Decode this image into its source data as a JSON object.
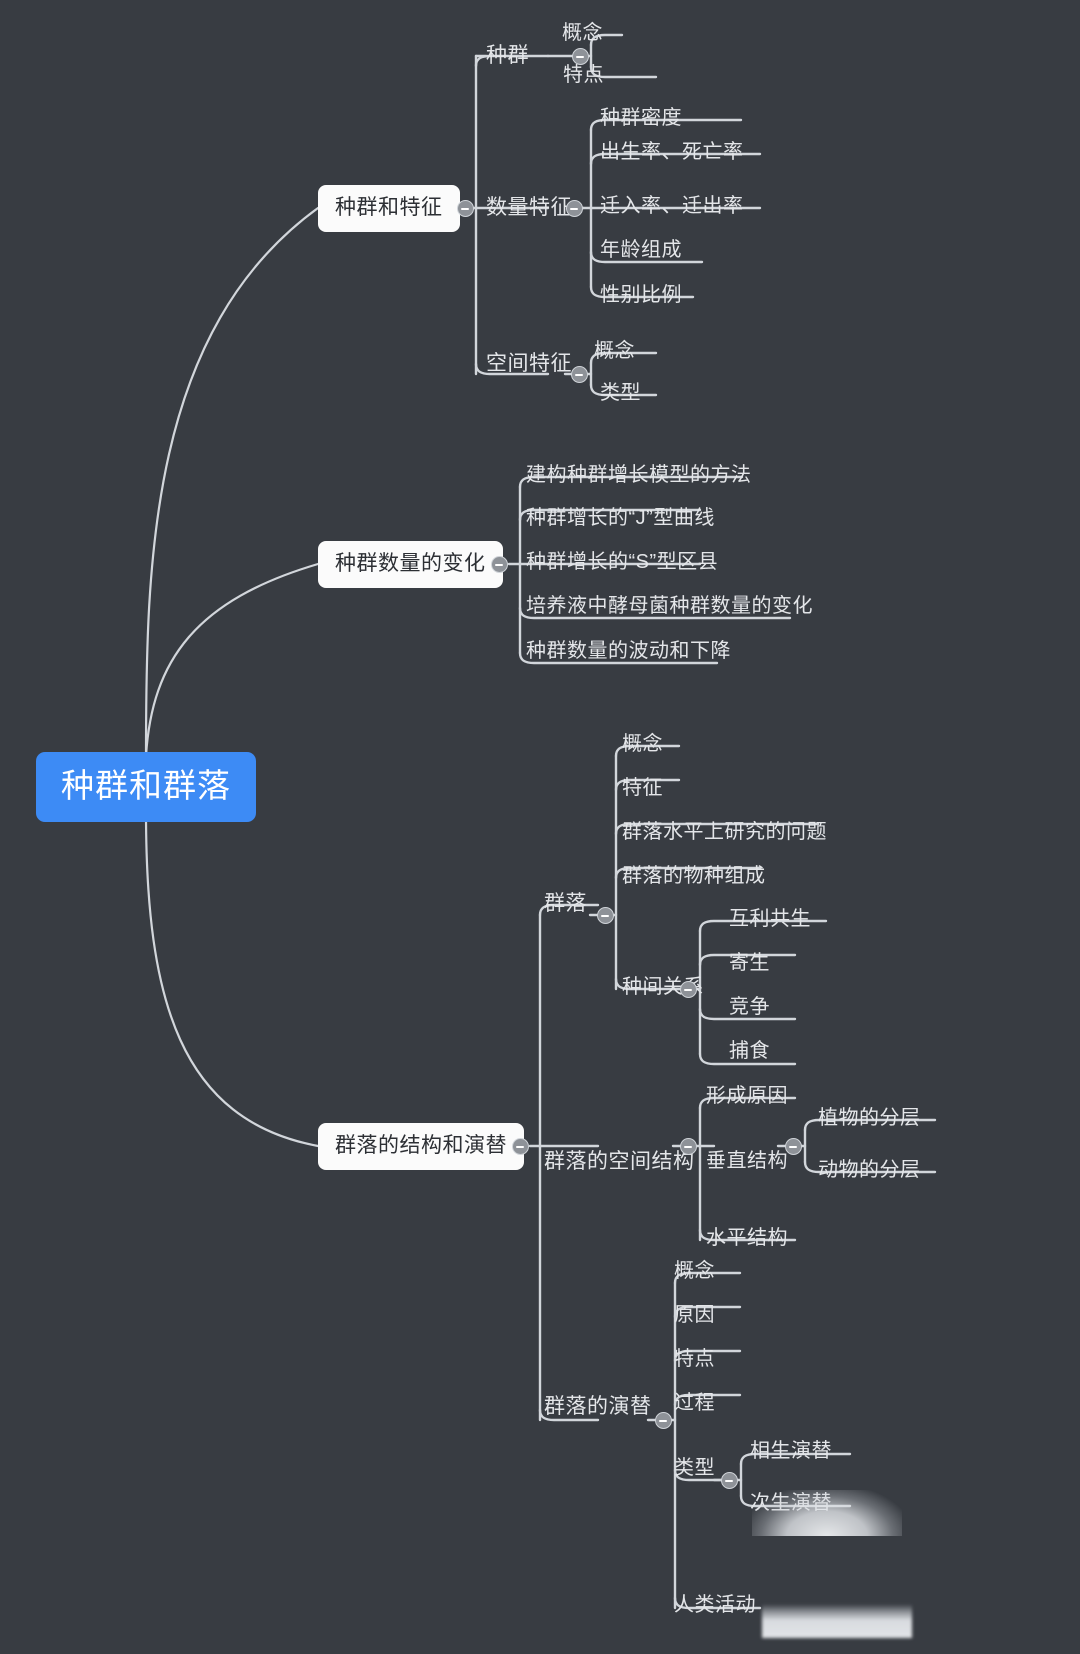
{
  "theme": {
    "background": "#383c42",
    "root_fill": "#3d8bf5",
    "root_text": "#ffffff",
    "box_fill": "#fbfbfb",
    "box_text": "#2c2f34",
    "branch_text": "#e4e6e9",
    "link_color": "#d2d6db",
    "toggle_fill": "#8e9298"
  },
  "root": {
    "label": "种群和群落"
  },
  "branches": [
    {
      "label": "种群和特征",
      "children": [
        {
          "label": "种群",
          "children": [
            {
              "label": "概念"
            },
            {
              "label": "特点"
            }
          ]
        },
        {
          "label": "数量特征",
          "children": [
            {
              "label": "种群密度"
            },
            {
              "label": "出生率、死亡率"
            },
            {
              "label": "迁入率、迁出率"
            },
            {
              "label": "年龄组成"
            },
            {
              "label": "性别比例"
            }
          ]
        },
        {
          "label": "空间特征",
          "children": [
            {
              "label": "概念"
            },
            {
              "label": "类型"
            }
          ]
        }
      ]
    },
    {
      "label": "种群数量的变化",
      "children": [
        {
          "label": "建构种群增长模型的方法"
        },
        {
          "label": "种群增长的“J”型曲线"
        },
        {
          "label": "种群增长的“S”型区县"
        },
        {
          "label": "培养液中酵母菌种群数量的变化"
        },
        {
          "label": "种群数量的波动和下降"
        }
      ]
    },
    {
      "label": "群落的结构和演替",
      "children": [
        {
          "label": "群落",
          "children": [
            {
              "label": "概念"
            },
            {
              "label": "特征"
            },
            {
              "label": "群落水平上研究的问题"
            },
            {
              "label": "群落的物种组成"
            },
            {
              "label": "种间关系",
              "children": [
                {
                  "label": "互利共生"
                },
                {
                  "label": "寄生"
                },
                {
                  "label": "竞争"
                },
                {
                  "label": "捕食"
                }
              ]
            }
          ]
        },
        {
          "label": "群落的空间结构",
          "children": [
            {
              "label": "形成原因"
            },
            {
              "label": "垂直结构",
              "children": [
                {
                  "label": "植物的分层"
                },
                {
                  "label": "动物的分层"
                }
              ]
            },
            {
              "label": "水平结构"
            }
          ]
        },
        {
          "label": "群落的演替",
          "children": [
            {
              "label": "概念"
            },
            {
              "label": "原因"
            },
            {
              "label": "特点"
            },
            {
              "label": "过程"
            },
            {
              "label": "类型",
              "children": [
                {
                  "label": "相生演替"
                },
                {
                  "label": "次生演替"
                }
              ]
            },
            {
              "label": "人类活动"
            }
          ]
        }
      ]
    }
  ],
  "nodes": {
    "root": "种群和群落",
    "b1": "种群和特征",
    "b1_c1": "种群",
    "b1_c1_g1": "概念",
    "b1_c1_g2": "特点",
    "b1_c2": "数量特征",
    "b1_c2_g1": "种群密度",
    "b1_c2_g2": "出生率、死亡率",
    "b1_c2_g3": "迁入率、迁出率",
    "b1_c2_g4": "年龄组成",
    "b1_c2_g5": "性别比例",
    "b1_c3": "空间特征",
    "b1_c3_g1": "概念",
    "b1_c3_g2": "类型",
    "b2": "种群数量的变化",
    "b2_c1": "建构种群增长模型的方法",
    "b2_c2": "种群增长的“J”型曲线",
    "b2_c3": "种群增长的“S”型区县",
    "b2_c4": "培养液中酵母菌种群数量的变化",
    "b2_c5": "种群数量的波动和下降",
    "b3": "群落的结构和演替",
    "b3_c1": "群落",
    "b3_c1_g1": "概念",
    "b3_c1_g2": "特征",
    "b3_c1_g3": "群落水平上研究的问题",
    "b3_c1_g4": "群落的物种组成",
    "b3_c1_g5": "种间关系",
    "b3_c1_g5_h1": "互利共生",
    "b3_c1_g5_h2": "寄生",
    "b3_c1_g5_h3": "竞争",
    "b3_c1_g5_h4": "捕食",
    "b3_c2": "群落的空间结构",
    "b3_c2_g1": "形成原因",
    "b3_c2_g2": "垂直结构",
    "b3_c2_g2_h1": "植物的分层",
    "b3_c2_g2_h2": "动物的分层",
    "b3_c2_g3": "水平结构",
    "b3_c3": "群落的演替",
    "b3_c3_g1": "概念",
    "b3_c3_g2": "原因",
    "b3_c3_g3": "特点",
    "b3_c3_g4": "过程",
    "b3_c3_g5": "类型",
    "b3_c3_g5_h1": "相生演替",
    "b3_c3_g5_h2": "次生演替",
    "b3_c3_g6": "人类活动"
  }
}
